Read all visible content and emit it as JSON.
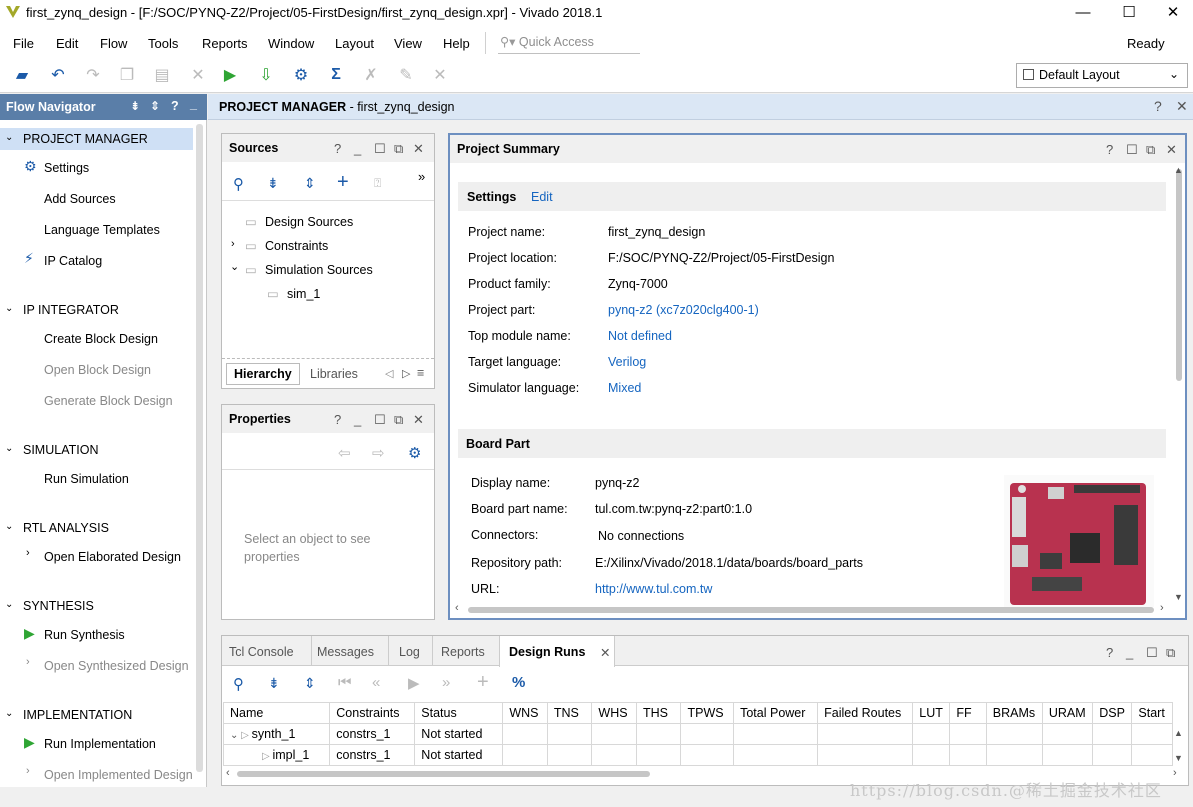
{
  "window": {
    "title": "first_zynq_design - [F:/SOC/PYNQ-Z2/Project/05-FirstDesign/first_zynq_design.xpr] - Vivado 2018.1",
    "controls": [
      "—",
      "☐",
      "✕"
    ]
  },
  "menu": {
    "items": [
      "File",
      "Edit",
      "Flow",
      "Tools",
      "Reports",
      "Window",
      "Layout",
      "View",
      "Help"
    ],
    "quick_access_placeholder": "Quick Access",
    "status": "Ready"
  },
  "toolbar": {
    "layout_selected": "Default Layout"
  },
  "flow_nav": {
    "title": "Flow Navigator",
    "sections": [
      {
        "label": "PROJECT MANAGER",
        "items": [
          "Settings",
          "Add Sources",
          "Language Templates",
          "IP Catalog"
        ]
      },
      {
        "label": "IP INTEGRATOR",
        "items": [
          "Create Block Design",
          "Open Block Design",
          "Generate Block Design"
        ]
      },
      {
        "label": "SIMULATION",
        "items": [
          "Run Simulation"
        ]
      },
      {
        "label": "RTL ANALYSIS",
        "items": [
          "Open Elaborated Design"
        ]
      },
      {
        "label": "SYNTHESIS",
        "items": [
          "Run Synthesis",
          "Open Synthesized Design"
        ]
      },
      {
        "label": "IMPLEMENTATION",
        "items": [
          "Run Implementation",
          "Open Implemented Design"
        ]
      }
    ]
  },
  "pm_header": {
    "bold": "PROJECT MANAGER",
    "rest": " - first_zynq_design",
    "help": "?",
    "close": "✕"
  },
  "sources": {
    "title": "Sources",
    "tree": [
      "Design Sources",
      "Constraints",
      "Simulation Sources",
      "sim_1"
    ],
    "tabs": [
      "Hierarchy",
      "Libraries"
    ]
  },
  "properties": {
    "title": "Properties",
    "hint": "Select an object to see properties"
  },
  "summary": {
    "title": "Project Summary",
    "settings_label": "Settings",
    "edit_label": "Edit",
    "rows": [
      {
        "k": "Project name:",
        "v": "first_zynq_design"
      },
      {
        "k": "Project location:",
        "v": "F:/SOC/PYNQ-Z2/Project/05-FirstDesign"
      },
      {
        "k": "Product family:",
        "v": "Zynq-7000"
      },
      {
        "k": "Project part:",
        "v": "pynq-z2 (xc7z020clg400-1)"
      },
      {
        "k": "Top module name:",
        "v": "Not defined"
      },
      {
        "k": "Target language:",
        "v": "Verilog"
      },
      {
        "k": "Simulator language:",
        "v": "Mixed"
      }
    ],
    "board_label": "Board Part",
    "board_rows": [
      {
        "k": "Display name:",
        "v": "pynq-z2"
      },
      {
        "k": "Board part name:",
        "v": "tul.com.tw:pynq-z2:part0:1.0"
      },
      {
        "k": "Connectors:",
        "v": "No connections"
      },
      {
        "k": "Repository path:",
        "v": "E:/Xilinx/Vivado/2018.1/data/boards/board_parts"
      },
      {
        "k": "URL:",
        "v": "http://www.tul.com.tw"
      }
    ]
  },
  "bottom": {
    "tabs": [
      "Tcl Console",
      "Messages",
      "Log",
      "Reports",
      "Design Runs"
    ],
    "columns": [
      "Name",
      "Constraints",
      "Status",
      "WNS",
      "TNS",
      "WHS",
      "THS",
      "TPWS",
      "Total Power",
      "Failed Routes",
      "LUT",
      "FF",
      "BRAMs",
      "URAM",
      "DSP",
      "Start"
    ],
    "rows": [
      {
        "name": "synth_1",
        "constraints": "constrs_1",
        "status": "Not started"
      },
      {
        "name": "impl_1",
        "constraints": "constrs_1",
        "status": "Not started"
      }
    ]
  },
  "watermark": "https://blog.csdn.@稀土掘金技术社区"
}
